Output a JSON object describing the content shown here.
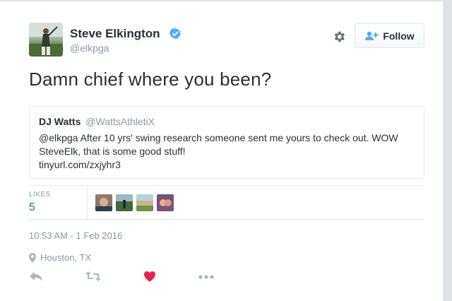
{
  "tweet": {
    "author_name": "Steve Elkington",
    "author_handle": "@elkpga",
    "text": "Damn chief where you been?",
    "follow_label": "Follow"
  },
  "quote": {
    "name": "DJ Watts",
    "handle": "@WattsAthletiX",
    "line1": "@elkpga After 10 yrs' swing research someone sent me yours to check out. WOW",
    "line2": "SteveElk, that is some good stuff!",
    "line3": "tinyurl.com/zxjyhr3"
  },
  "stats": {
    "likes_label": "LIKES",
    "likes_count": "5"
  },
  "meta": {
    "timestamp": "10:53 AM - 1 Feb 2016",
    "location": "Houston, TX"
  },
  "colors": {
    "like_heart": "#e81c4f",
    "icon_gray": "#aab8c2",
    "likes_green": "#1c8a4e",
    "verified_blue": "#55acee"
  },
  "icons": [
    "verified-badge-icon",
    "gear-icon",
    "follow-person-icon",
    "location-pin-icon",
    "reply-icon",
    "retweet-icon",
    "heart-icon",
    "more-icon"
  ]
}
